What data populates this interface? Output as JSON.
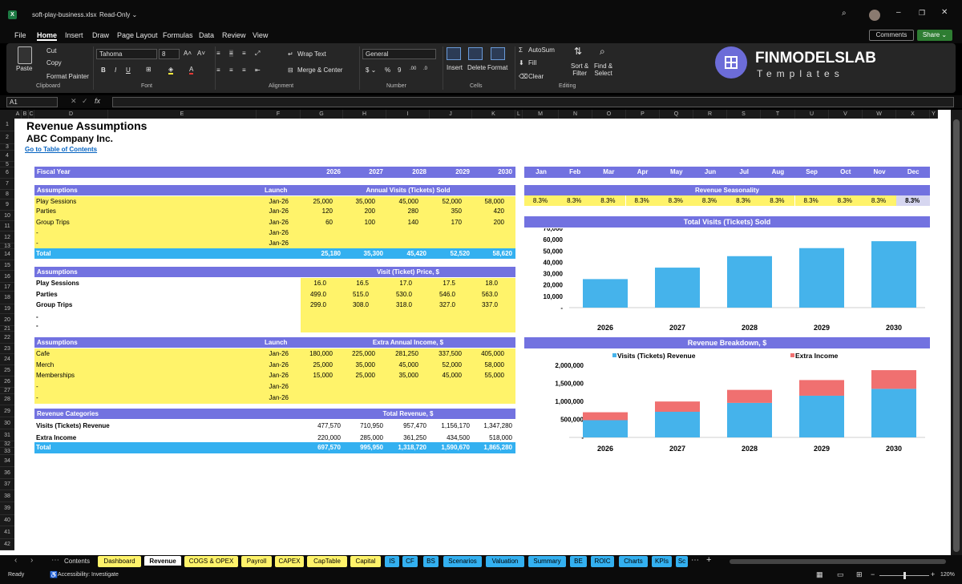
{
  "window": {
    "filename": "soft-play-business.xlsx",
    "mode": "Read-Only ⌄"
  },
  "menus": [
    "File",
    "Home",
    "Insert",
    "Draw",
    "Page Layout",
    "Formulas",
    "Data",
    "Review",
    "View"
  ],
  "buttons": {
    "comments": "Comments",
    "share": "Share ⌄"
  },
  "ribbon": {
    "paste": "Paste",
    "cut": "Cut",
    "copy": "Copy",
    "format_painter": "Format Painter",
    "font_name": "Tahoma",
    "font_size": "8",
    "wrap": "Wrap Text",
    "merge": "Merge & Center",
    "number_format": "General",
    "insert": "Insert",
    "delete": "Delete",
    "format": "Format",
    "autosum": "AutoSum",
    "fill": "Fill",
    "clear": "Clear",
    "sort": "Sort &\nFilter",
    "find": "Find &\nSelect",
    "groups": [
      "Clipboard",
      "Font",
      "Alignment",
      "Number",
      "Cells",
      "Editing"
    ]
  },
  "logo": {
    "name": "FINMODELSLAB",
    "sub": "Templates"
  },
  "formula": {
    "namebox": "A1",
    "fx": "fx"
  },
  "columns": [
    "A",
    "B",
    "C",
    "D",
    "E",
    "F",
    "G",
    "H",
    "I",
    "J",
    "K",
    "L",
    "M",
    "N",
    "O",
    "P",
    "Q",
    "R",
    "S",
    "T",
    "U",
    "V",
    "W",
    "X",
    "Y"
  ],
  "rows": [
    "1",
    "2",
    "3",
    "4",
    "5",
    "6",
    "7",
    "8",
    "9",
    "10",
    "11",
    "12",
    "13",
    "14",
    "15",
    "16",
    "17",
    "18",
    "19",
    "20",
    "21",
    "22",
    "23",
    "24",
    "25",
    "26",
    "27",
    "28",
    "29",
    "30",
    "31",
    "32",
    "33",
    "34",
    "36",
    "37",
    "38",
    "39",
    "40",
    "41",
    "42"
  ],
  "sheet": {
    "title": "Revenue Assumptions",
    "company": "ABC Company Inc.",
    "link": "Go to Table of Contents",
    "fiscal_year": "Fiscal Year",
    "years": [
      "2026",
      "2027",
      "2028",
      "2029",
      "2030"
    ],
    "months": [
      "Jan",
      "Feb",
      "Mar",
      "Apr",
      "May",
      "Jun",
      "Jul",
      "Aug",
      "Sep",
      "Oct",
      "Nov",
      "Dec"
    ],
    "assumptions": "Assumptions",
    "launch": "Launch",
    "visits_hdr": "Annual Visits (Tickets) Sold",
    "visits": [
      {
        "name": "Play Sessions",
        "launch": "Jan-26",
        "vals": [
          "25,000",
          "35,000",
          "45,000",
          "52,000",
          "58,000"
        ]
      },
      {
        "name": "Parties",
        "launch": "Jan-26",
        "vals": [
          "120",
          "200",
          "280",
          "350",
          "420"
        ]
      },
      {
        "name": "Group Trips",
        "launch": "Jan-26",
        "vals": [
          "60",
          "100",
          "140",
          "170",
          "200"
        ]
      },
      {
        "name": "-",
        "launch": "Jan-26",
        "vals": [
          "",
          "",
          "",
          "",
          ""
        ]
      },
      {
        "name": "-",
        "launch": "Jan-26",
        "vals": [
          "",
          "",
          "",
          "",
          ""
        ]
      }
    ],
    "total": "Total",
    "visits_total": [
      "25,180",
      "35,300",
      "45,420",
      "52,520",
      "58,620"
    ],
    "price_hdr": "Visit (Ticket) Price, $",
    "prices": [
      {
        "name": "Play Sessions",
        "vals": [
          "16.0",
          "16.5",
          "17.0",
          "17.5",
          "18.0"
        ]
      },
      {
        "name": "Parties",
        "vals": [
          "499.0",
          "515.0",
          "530.0",
          "546.0",
          "563.0"
        ]
      },
      {
        "name": "Group Trips",
        "vals": [
          "299.0",
          "308.0",
          "318.0",
          "327.0",
          "337.0"
        ]
      },
      {
        "name": "-",
        "vals": [
          "",
          "",
          "",
          "",
          ""
        ]
      },
      {
        "name": "-",
        "vals": [
          "",
          "",
          "",
          "",
          ""
        ]
      }
    ],
    "extra_hdr": "Extra Annual Income, $",
    "extra": [
      {
        "name": "Cafe",
        "launch": "Jan-26",
        "vals": [
          "180,000",
          "225,000",
          "281,250",
          "337,500",
          "405,000"
        ]
      },
      {
        "name": "Merch",
        "launch": "Jan-26",
        "vals": [
          "25,000",
          "35,000",
          "45,000",
          "52,000",
          "58,000"
        ]
      },
      {
        "name": "Memberships",
        "launch": "Jan-26",
        "vals": [
          "15,000",
          "25,000",
          "35,000",
          "45,000",
          "55,000"
        ]
      },
      {
        "name": "-",
        "launch": "Jan-26",
        "vals": [
          "",
          "",
          "",
          "",
          ""
        ]
      },
      {
        "name": "-",
        "launch": "Jan-26",
        "vals": [
          "",
          "",
          "",
          "",
          ""
        ]
      }
    ],
    "rev_cat": "Revenue Categories",
    "rev_hdr": "Total Revenue, $",
    "revenue": [
      {
        "name": "Visits (Tickets) Revenue",
        "vals": [
          "477,570",
          "710,950",
          "957,470",
          "1,156,170",
          "1,347,280"
        ]
      },
      {
        "name": "Extra Income",
        "vals": [
          "220,000",
          "285,000",
          "361,250",
          "434,500",
          "518,000"
        ]
      }
    ],
    "rev_total": [
      "697,570",
      "995,950",
      "1,318,720",
      "1,590,670",
      "1,865,280"
    ],
    "season_hdr": "Revenue Seasonality",
    "season": [
      "8.3%",
      "8.3%",
      "8.3%",
      "8.3%",
      "8.3%",
      "8.3%",
      "8.3%",
      "8.3%",
      "8.3%",
      "8.3%",
      "8.3%",
      "8.3%"
    ]
  },
  "chart_data": [
    {
      "type": "bar",
      "title": "Total Visits (Tickets) Sold",
      "categories": [
        "2026",
        "2027",
        "2028",
        "2029",
        "2030"
      ],
      "values": [
        25180,
        35300,
        45420,
        52520,
        58620
      ],
      "ylim": [
        0,
        70000
      ],
      "yticks": [
        "70,000",
        "60,000",
        "50,000",
        "40,000",
        "30,000",
        "20,000",
        "10,000",
        "-"
      ],
      "color": "#45b3eb"
    },
    {
      "type": "bar",
      "title": "Revenue Breakdown, $",
      "categories": [
        "2026",
        "2027",
        "2028",
        "2029",
        "2030"
      ],
      "series": [
        {
          "name": "Visits (Tickets) Revenue",
          "values": [
            477570,
            710950,
            957470,
            1156170,
            1347280
          ],
          "color": "#45b3eb"
        },
        {
          "name": "Extra Income",
          "values": [
            220000,
            285000,
            361250,
            434500,
            518000
          ],
          "color": "#f07070"
        }
      ],
      "ylim": [
        0,
        2000000
      ],
      "yticks": [
        "2,000,000",
        "1,500,000",
        "1,000,000",
        "500,000",
        "-"
      ]
    }
  ],
  "sheet_tabs": [
    {
      "label": "Contents",
      "color": "#0b0b0b",
      "text": "#ddd"
    },
    {
      "label": "Dashboard",
      "color": "#fff36a",
      "text": "#000"
    },
    {
      "label": "Revenue",
      "color": "#ffffff",
      "text": "#000"
    },
    {
      "label": "COGS & OPEX",
      "color": "#fff36a",
      "text": "#000"
    },
    {
      "label": "Payroll",
      "color": "#fff36a",
      "text": "#000"
    },
    {
      "label": "CAPEX",
      "color": "#fff36a",
      "text": "#000"
    },
    {
      "label": "CapTable",
      "color": "#fff36a",
      "text": "#000"
    },
    {
      "label": "Capital",
      "color": "#fff36a",
      "text": "#000"
    },
    {
      "label": "IS",
      "color": "#33b0f0",
      "text": "#000"
    },
    {
      "label": "CF",
      "color": "#33b0f0",
      "text": "#000"
    },
    {
      "label": "BS",
      "color": "#33b0f0",
      "text": "#000"
    },
    {
      "label": "Scenarios",
      "color": "#33b0f0",
      "text": "#000"
    },
    {
      "label": "Valuation",
      "color": "#33b0f0",
      "text": "#000"
    },
    {
      "label": "Summary",
      "color": "#33b0f0",
      "text": "#000"
    },
    {
      "label": "BE",
      "color": "#33b0f0",
      "text": "#000"
    },
    {
      "label": "ROIC",
      "color": "#33b0f0",
      "text": "#000"
    },
    {
      "label": "Charts",
      "color": "#33b0f0",
      "text": "#000"
    },
    {
      "label": "KPIs",
      "color": "#33b0f0",
      "text": "#000"
    },
    {
      "label": "Sc",
      "color": "#33b0f0",
      "text": "#000"
    }
  ],
  "status": {
    "ready": "Ready",
    "accessibility": "Accessibility: Investigate",
    "zoom": "120%"
  }
}
